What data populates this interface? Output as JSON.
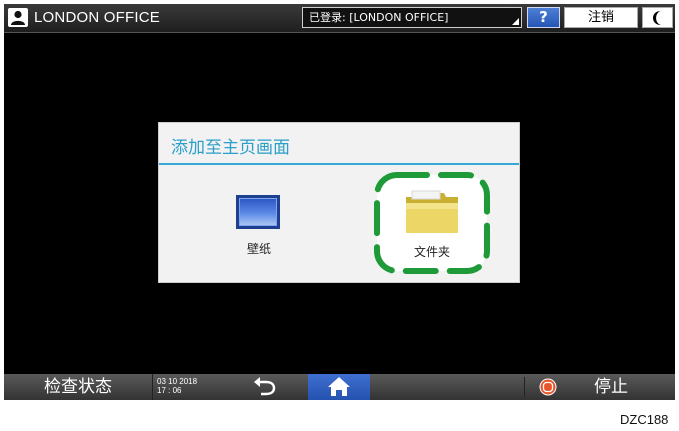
{
  "topbar": {
    "office_title": "LONDON OFFICE",
    "login_label": "已登录: [LONDON OFFICE]",
    "help_label": "?",
    "logout_label": "注销",
    "sleep_label": "("
  },
  "dialog": {
    "title": "添加至主页画面",
    "tiles": [
      {
        "label": "壁纸",
        "icon": "wallpaper-icon"
      },
      {
        "label": "文件夹",
        "icon": "folder-icon",
        "highlighted": true
      }
    ]
  },
  "bottombar": {
    "check_status_label": "检查状态",
    "date": "03 10 2018",
    "time": "17 : 06",
    "stop_label": "停止"
  },
  "caption": "DZC188",
  "colors": {
    "accent_blue": "#2a9fc9",
    "highlight_green": "#22a83a",
    "home_blue": "#2d5fc4",
    "stop_orange": "#e8552a"
  }
}
